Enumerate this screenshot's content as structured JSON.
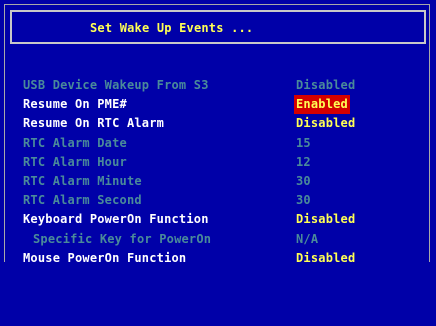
{
  "header": {
    "title": "Set Wake Up Events ..."
  },
  "rows": [
    {
      "label": "USB Device Wakeup From S3",
      "value": "Disabled",
      "state": "dim"
    },
    {
      "label": "Resume On PME#",
      "value": "Enabled",
      "state": "selected"
    },
    {
      "label": "Resume On RTC Alarm",
      "value": "Disabled",
      "state": "active"
    },
    {
      "label": "RTC Alarm Date",
      "value": "15",
      "state": "dim"
    },
    {
      "label": "RTC Alarm Hour",
      "value": "12",
      "state": "dim"
    },
    {
      "label": "RTC Alarm Minute",
      "value": "30",
      "state": "dim"
    },
    {
      "label": "RTC Alarm Second",
      "value": "30",
      "state": "dim"
    },
    {
      "label": "Keyboard PowerOn Function",
      "value": "Disabled",
      "state": "active"
    },
    {
      "label": "Specific Key for PowerOn",
      "value": "N/A",
      "state": "dim",
      "indent": true
    },
    {
      "label": "Mouse PowerOn Function",
      "value": "Disabled",
      "state": "active"
    }
  ],
  "colors": {
    "background": "#0000a8",
    "highlight": "#ffff54",
    "selection": "#d40000",
    "dimmed": "#4a8a9a",
    "text": "#ffffff"
  }
}
